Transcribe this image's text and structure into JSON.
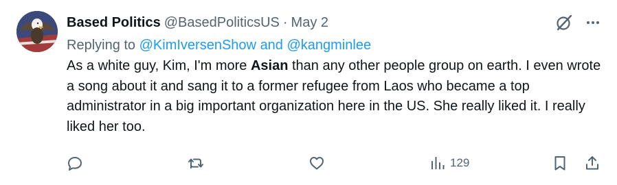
{
  "tweet": {
    "display_name": "Based Politics",
    "handle": "@BasedPoliticsUS",
    "separator": "·",
    "date": "May 2",
    "replying_prefix": "Replying to",
    "reply_mention_1": "@KimIversenShow",
    "reply_and": "and",
    "reply_mention_2": "@kangminlee",
    "body_part1": "As a white guy, Kim, I'm more ",
    "body_bold": "Asian",
    "body_part2": " than any other people group on earth.  I even wrote a song about it and sang it to a former refugee from Laos who became a top administrator in a big important organization here in the US.  She really liked it.  I really liked her too."
  },
  "actions": {
    "views_count": "129"
  },
  "colors": {
    "text": "#0f1419",
    "muted": "#536471",
    "link": "#1d9bf0"
  },
  "icons": [
    "avatar-eagle-icon",
    "grok-icon",
    "more-icon",
    "reply-icon",
    "repost-icon",
    "like-icon",
    "views-icon",
    "bookmark-icon",
    "share-icon"
  ]
}
